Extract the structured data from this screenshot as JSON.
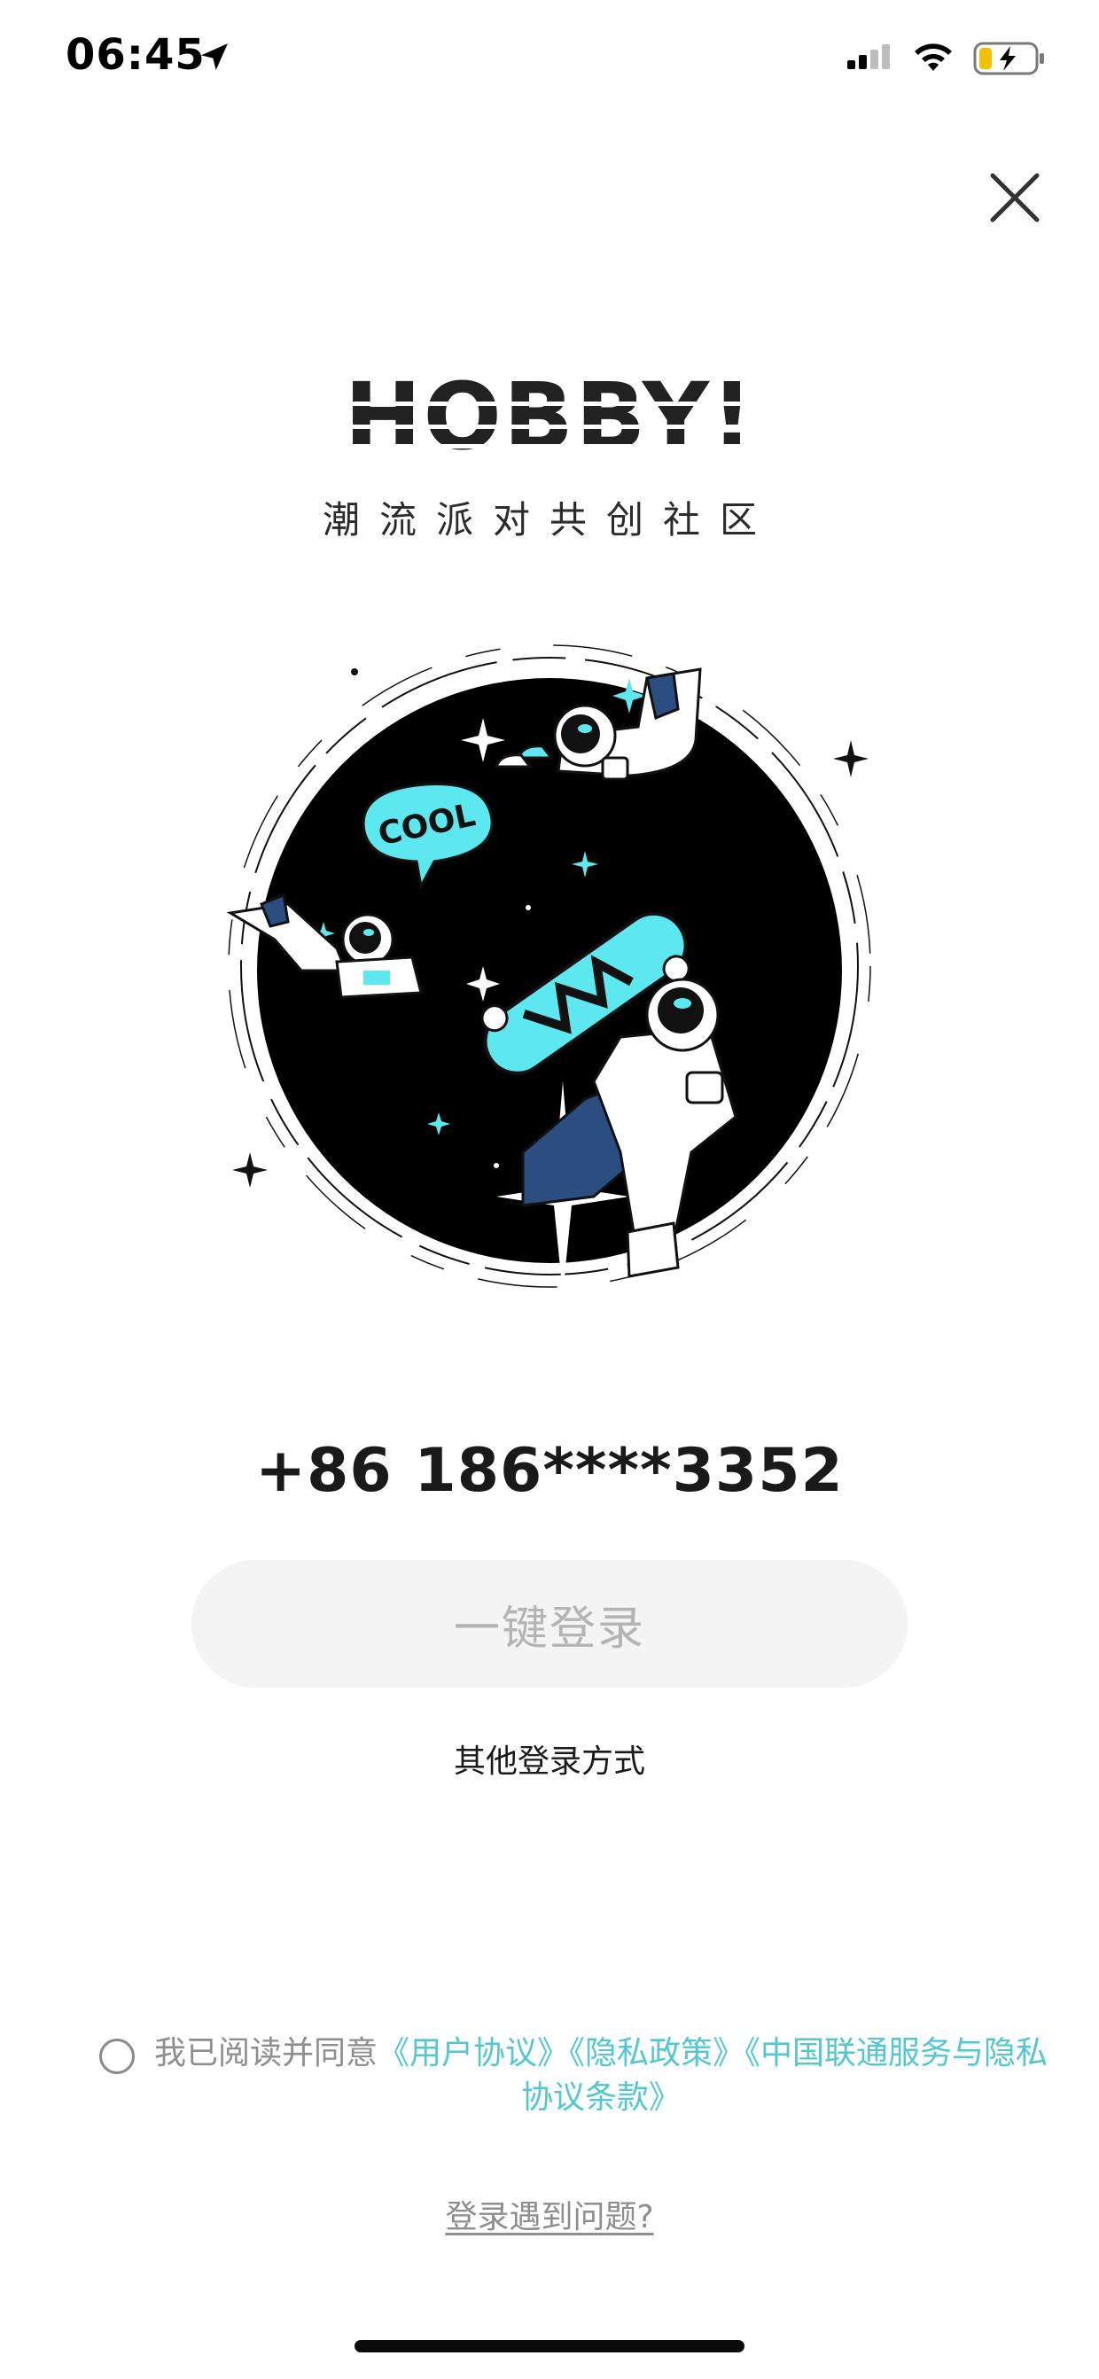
{
  "status_bar": {
    "time": "06:45",
    "icons": [
      "location-arrow-icon",
      "cellular-signal-icon",
      "wifi-icon",
      "battery-charging-icon"
    ]
  },
  "header": {
    "close_icon": "close-icon"
  },
  "brand": {
    "logo_text": "HOBBY!",
    "subtitle": "潮流派对共创社区",
    "illustration_badge": "COOL",
    "colors": {
      "logo": "#222222",
      "space": "#000000",
      "accent": "#5ce8ee",
      "suit_accent": "#2b4d80"
    }
  },
  "login": {
    "phone_number": "+86 186****3352",
    "one_tap_label": "一键登录",
    "other_methods_label": "其他登录方式"
  },
  "agreement": {
    "checked": false,
    "prefix": "我已阅读并同意",
    "links": [
      "《用户协议》",
      "《隐私政策》",
      "《中国联通服务与隐私协议条款》"
    ],
    "link_color": "#52c7cf"
  },
  "help": {
    "label": "登录遇到问题?"
  }
}
